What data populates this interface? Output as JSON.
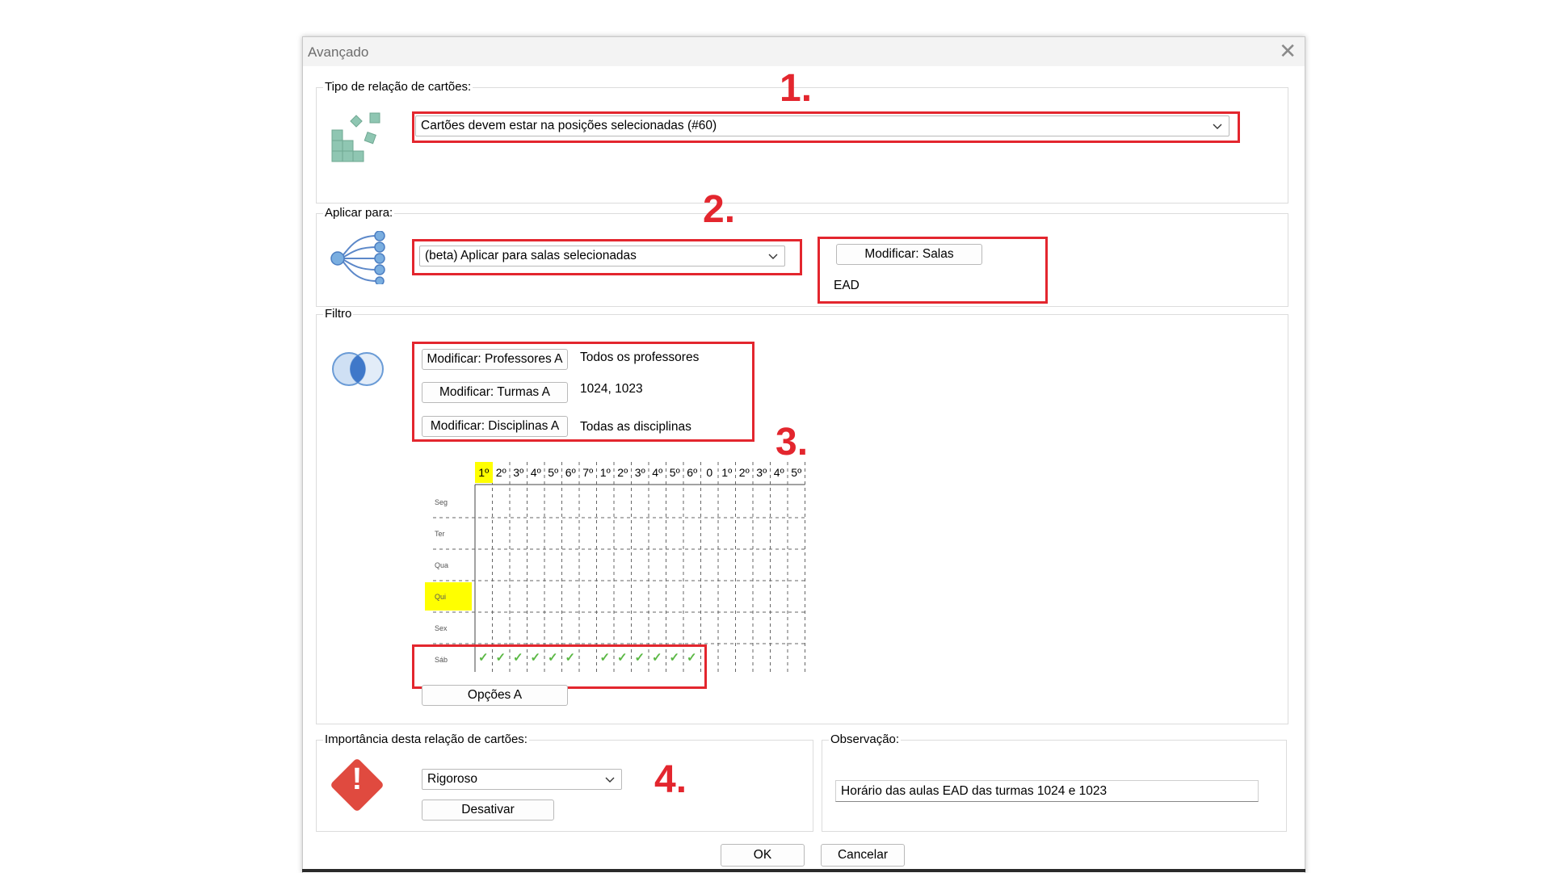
{
  "dialog": {
    "title": "Avançado",
    "close_glyph": "✕"
  },
  "group_tipo": {
    "label": "Tipo de relação de cartões:",
    "icon": "cards-arrangement-icon",
    "combo_value": "Cartões devem estar na posições selecionadas (#60)"
  },
  "group_aplicar": {
    "label": "Aplicar para:",
    "icon": "tree-branches-icon",
    "combo_value": "(beta) Aplicar para salas selecionadas",
    "modify_button": "Modificar: Salas",
    "selected_rooms": "EAD"
  },
  "group_filtro": {
    "label": "Filtro",
    "icon": "venn-circles-icon",
    "filters": [
      {
        "button": "Modificar: Professores A",
        "value": "Todos os professores"
      },
      {
        "button": "Modificar: Turmas A",
        "value": "1024, 1023"
      },
      {
        "button": "Modificar: Disciplinas A",
        "value": "Todas as disciplinas"
      }
    ],
    "grid": {
      "columns": [
        "1º",
        "2º",
        "3º",
        "4º",
        "5º",
        "6º",
        "7º",
        "1º",
        "2º",
        "3º",
        "4º",
        "5º",
        "6º",
        "0",
        "1º",
        "2º",
        "3º",
        "4º",
        "5º"
      ],
      "highlighted_column_index": 0,
      "rows": [
        "Seg",
        "Ter",
        "Qua",
        "Qui",
        "Sex",
        "Sáb"
      ],
      "highlighted_row": "Qui",
      "checked_row": "Sáb",
      "checked_columns": [
        0,
        1,
        2,
        3,
        4,
        5,
        7,
        8,
        9,
        10,
        11,
        12
      ],
      "check_glyph": "✓",
      "highlight_color": "#ffff00"
    },
    "options_button": "Opções A"
  },
  "group_importancia": {
    "label": "Importância desta relação de cartões:",
    "icon": "warning-diamond-icon",
    "icon_glyph": "!",
    "combo_value": "Rigoroso",
    "disable_button": "Desativar"
  },
  "group_obs": {
    "label": "Observação:",
    "value": "Horário das aulas EAD das turmas 1024 e 1023"
  },
  "footer": {
    "ok": "OK",
    "cancel": "Cancelar"
  },
  "annotations": {
    "n1": "1.",
    "n2": "2.",
    "n3": "3.",
    "n4": "4.",
    "color": "#e3262e"
  },
  "colors": {
    "icon_teal": "#8fc6b2",
    "icon_blue": "#7aaee0",
    "warning_red": "#e04a3f"
  }
}
